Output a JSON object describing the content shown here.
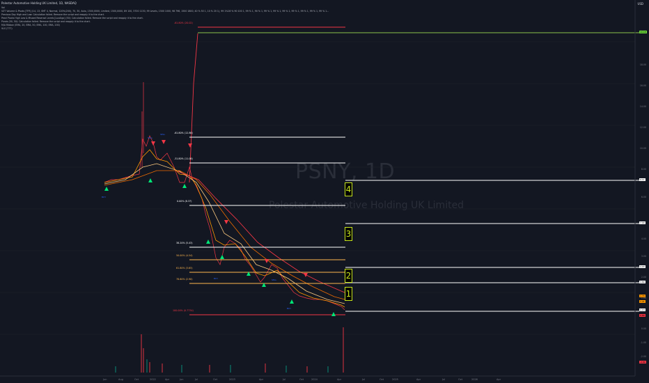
{
  "header": {
    "title": "Polestar Automotive Holding UK Limited, 1D, NASDAQ",
    "sub": "Vol",
    "indicators": [
      "VZT Volume & Pivots [TFR] (14, 13, SMT 4, Normal, 120%(200), 70, 30, Auto, 1500,0000, Limited, 1500,0000, 89 100, 5700 1130, 99 Levels, 1500 1000, 98 796, 1500 1800, 40 % 50 1, 10 % 20 1), 99 1%16 % 90 100 1, 99 % 1, 90 % 1, 99 % 1, 99 % 1, 99 % 1, 99 % 1, 99 % 1, 99 % 1, 99 % 1...",
      "Previous Day High and Low: Calculation failed. Remove the script and reapply it to the chart.",
      "Pearl Pivots High Low & Missed Reversal Levels [LuxAlgo] (50): Calculation failed. Remove the script and reapply it to the chart.",
      "Pivots (50, 50): Calculation failed. Remove the script and reapply it to the chart.",
      "M/A Ribbon (EMA, 20, EMA, 50, EMA, 100, EMA, 200)",
      "VLS (777)"
    ],
    "right_btn": "USD"
  },
  "watermark": {
    "ticker": "PSNY, 1D",
    "name": "Polestar Automotive Holding UK Limited"
  },
  "y_axis": [
    "20.00",
    "18.00",
    "16.00",
    "14.00",
    "12.00",
    "10.00",
    "8.00",
    "6.00",
    "4.00",
    "3.00",
    "2.00",
    "1.00",
    "0.00",
    "-1.00",
    "-2.00"
  ],
  "x_axis": [
    "Jun",
    "Aug",
    "Oct",
    "2022",
    "Apr",
    "Jun",
    "Jul",
    "Oct",
    "2023",
    "Apr",
    "Jul",
    "Oct",
    "2024",
    "Apr",
    "Jul",
    "Oct",
    "2025",
    "Apr",
    "Jul",
    "Oct",
    "2026",
    "Apr"
  ],
  "fib_levels": [
    {
      "label": "-61.80% (20.02)",
      "color": "#f23645"
    },
    {
      "label": "-61.80% (12.86)",
      "color": "#ffffff"
    },
    {
      "label": "-31.80% (11.06)",
      "color": "#ffffff"
    },
    {
      "label": "0.00% (8.37)",
      "color": "#ffffff"
    },
    {
      "label": "38.20% (5.43)",
      "color": "#ffffff"
    },
    {
      "label": "50.00% (4.54)",
      "color": "#ffb74d"
    },
    {
      "label": "61.80% (3.65)",
      "color": "#ffb74d"
    },
    {
      "label": "78.60% (2.90)",
      "color": "#ffb74d"
    },
    {
      "label": "100.00% (0.7734)",
      "color": "#f23645"
    }
  ],
  "price_tags": [
    {
      "text": "19.18",
      "bg": "#6ad53a"
    },
    {
      "text": "9.11",
      "bg": "#ffffff"
    },
    {
      "text": "7.00",
      "bg": "#ffffff"
    },
    {
      "text": "4.93",
      "bg": "#ffffff"
    },
    {
      "text": "3.80",
      "bg": "#ffffff"
    },
    {
      "text": "1.70",
      "bg": "#ff9800"
    },
    {
      "text": "1.21",
      "bg": "#ff9800"
    },
    {
      "text": "1.13",
      "bg": "#ffffff"
    },
    {
      "text": "0.89",
      "bg": "#f23645"
    },
    {
      "text": "-2.80",
      "bg": "#f23645"
    }
  ],
  "wave_boxes": [
    "4",
    "3",
    "2",
    "1"
  ],
  "signals": [
    "SELL",
    "BUY",
    "SELL",
    "BUY",
    "SELL",
    "BUY"
  ]
}
